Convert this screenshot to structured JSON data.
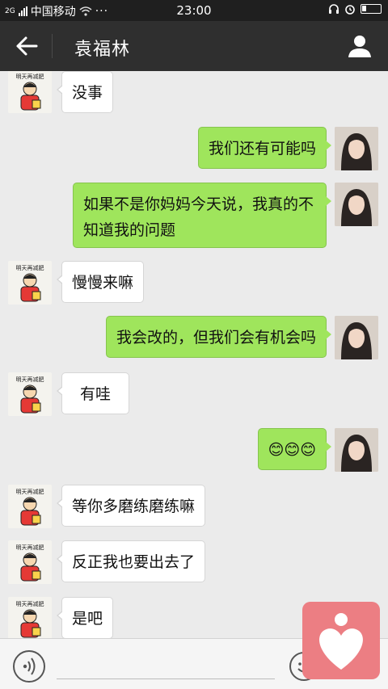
{
  "status_bar": {
    "carrier": "中国移动",
    "network": "2G",
    "time": "23:00"
  },
  "header": {
    "title": "袁福林",
    "back_icon": "arrow-left-icon",
    "profile_icon": "person-icon"
  },
  "messages": [
    {
      "side": "in",
      "text": "没事"
    },
    {
      "side": "out",
      "text": "我们还有可能吗"
    },
    {
      "side": "out",
      "text": "如果不是你妈妈今天说，我真的不知道我的问题"
    },
    {
      "side": "in",
      "text": "慢慢来嘛"
    },
    {
      "side": "out",
      "text": "我会改的，但我们会有机会吗"
    },
    {
      "side": "in",
      "text": "有哇"
    },
    {
      "side": "out",
      "text": "😊😊😊"
    },
    {
      "side": "in",
      "text": "等你多磨练磨练嘛"
    },
    {
      "side": "in",
      "text": "反正我也要出去了"
    },
    {
      "side": "in",
      "text": "是吧"
    }
  ],
  "contact_avatar_caption": "明天再减肥",
  "input_bar": {
    "placeholder": "",
    "voice_icon": "voice-icon",
    "emoji_icon": "emoji-icon"
  },
  "colors": {
    "header_bg": "#2f2f2f",
    "chat_bg": "#ebebeb",
    "outgoing_bubble": "#9fe55c",
    "incoming_bubble": "#ffffff",
    "floating_button": "#ec7e83"
  }
}
